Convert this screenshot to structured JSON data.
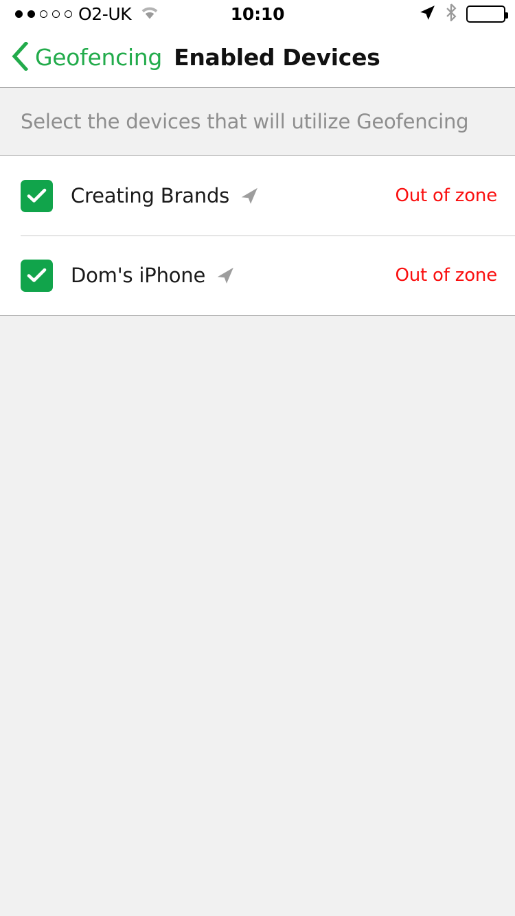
{
  "status_bar": {
    "signal_dots_filled": 2,
    "signal_dots_total": 5,
    "carrier": "O2-UK",
    "wifi_icon": "wifi-icon",
    "time": "10:10",
    "location_icon": "location-arrow-icon",
    "bluetooth_icon": "bluetooth-icon",
    "battery_icon": "battery-full-icon"
  },
  "nav": {
    "back_icon": "chevron-left-icon",
    "back_label": "Geofencing",
    "title": "Enabled Devices",
    "accent_color": "#22ab4b"
  },
  "section": {
    "header_text": "Select the devices that will utilize Geofencing"
  },
  "devices": [
    {
      "name": "Creating Brands",
      "checked": true,
      "location_icon": "location-arrow-icon",
      "status": "Out of zone"
    },
    {
      "name": "Dom's iPhone",
      "checked": true,
      "location_icon": "location-arrow-icon",
      "status": "Out of zone"
    }
  ],
  "colors": {
    "checkbox_green": "#11a44b",
    "status_red": "#fa0f0f",
    "page_background": "#f1f1f1",
    "row_background": "#ffffff",
    "section_text": "#8e8e8e"
  }
}
